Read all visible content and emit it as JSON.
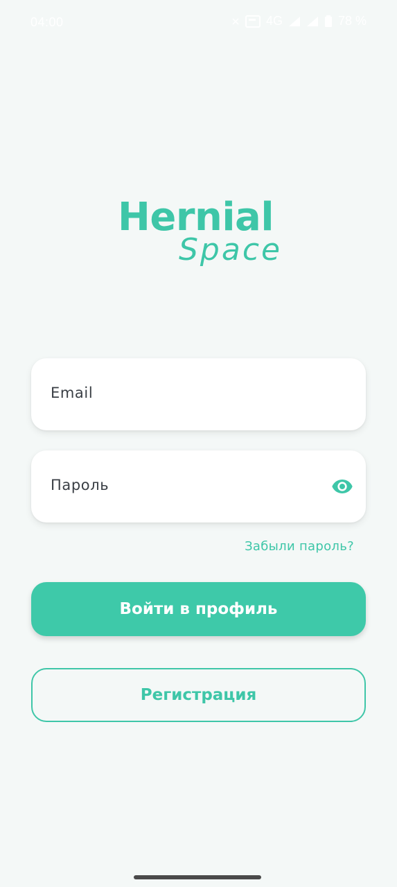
{
  "status_bar": {
    "time": "04:00",
    "network": "4G",
    "battery": "78 %"
  },
  "logo": {
    "line1": "Hernial",
    "line2": "Space"
  },
  "form": {
    "email_placeholder": "Email",
    "password_placeholder": "Пароль",
    "forgot_password": "Забыли пароль?"
  },
  "buttons": {
    "login": "Войти в профиль",
    "register": "Регистрация"
  },
  "colors": {
    "accent": "#3ec6a8",
    "background": "#f4f8f7"
  },
  "icons": {
    "password_toggle": "eye-icon"
  }
}
